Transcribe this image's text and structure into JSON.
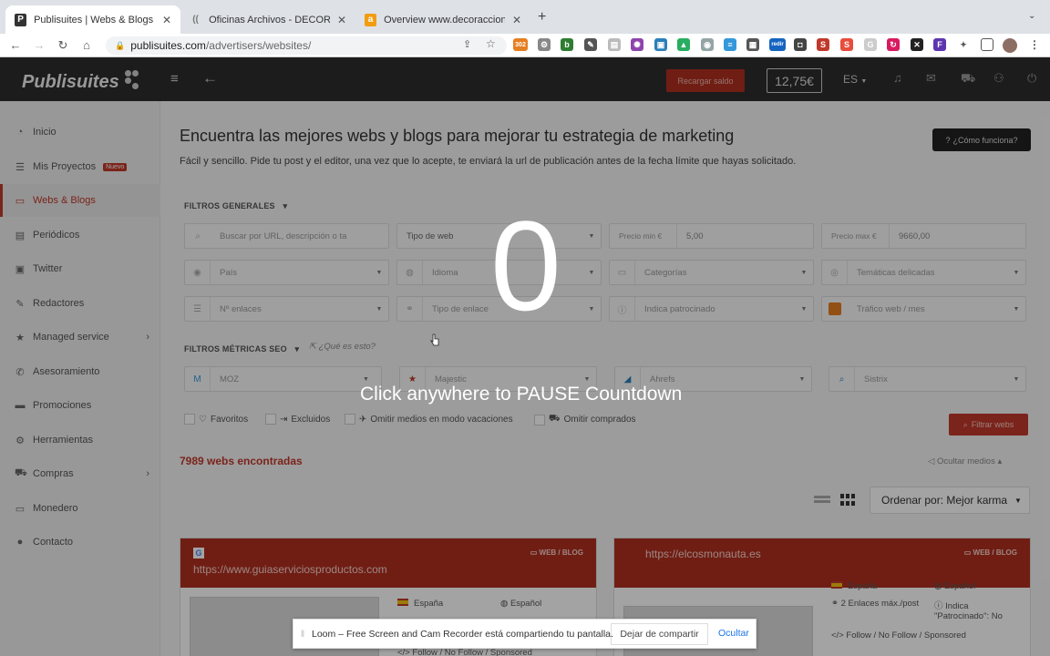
{
  "browser": {
    "tabs": [
      {
        "title": "Publisuites | Webs & Blogs",
        "favicon": "P"
      },
      {
        "title": "Oficinas Archivos - DECORACC",
        "favicon": "(("
      },
      {
        "title": "Overview www.decoraccion.es",
        "favicon": "a"
      }
    ],
    "new_tab": "+",
    "url_host": "publisuites.com",
    "url_path": "/advertisers/websites/",
    "ext_badge_302": "302",
    "ext_badge_redir": "redir"
  },
  "header": {
    "logo": "Publisuites",
    "recharge_label": "Recargar saldo",
    "balance": "12,75€",
    "lang": "ES"
  },
  "sidebar": {
    "items": [
      {
        "label": "Inicio",
        "icon": "dashboard-icon"
      },
      {
        "label": "Mis Proyectos",
        "icon": "list-icon",
        "badge": "Nuevo"
      },
      {
        "label": "Webs & Blogs",
        "icon": "webs-icon"
      },
      {
        "label": "Periódicos",
        "icon": "newspaper-icon"
      },
      {
        "label": "Twitter",
        "icon": "twitter-icon"
      },
      {
        "label": "Redactores",
        "icon": "pencil-icon"
      },
      {
        "label": "Managed service",
        "icon": "star-icon"
      },
      {
        "label": "Asesoramiento",
        "icon": "phone-icon"
      },
      {
        "label": "Promociones",
        "icon": "ticket-icon"
      },
      {
        "label": "Herramientas",
        "icon": "tools-icon"
      },
      {
        "label": "Compras",
        "icon": "cart-icon"
      },
      {
        "label": "Monedero",
        "icon": "wallet-icon"
      },
      {
        "label": "Contacto",
        "icon": "info-icon"
      }
    ]
  },
  "main": {
    "title": "Encuentra las mejores webs y blogs para mejorar tu estrategia de marketing",
    "subtitle": "Fácil y sencillo. Pide tu post y el editor, una vez que lo acepte, te enviará la url de publicación antes de la fecha límite que hayas solicitado.",
    "how_button": "¿Cómo funciona?",
    "filters_general": "FILTROS GENERALES",
    "search_placeholder": "Buscar por URL, descripción o ta",
    "web_type": "Tipo de web",
    "price_min_label": "Precio min €",
    "price_min_value": "5,00",
    "price_max_label": "Precio max €",
    "price_max_value": "9660,00",
    "country": "País",
    "language": "Idioma",
    "categories": "Categorías",
    "sensitive": "Temáticas delicadas",
    "links": "Nº enlaces",
    "link_type": "Tipo de enlace",
    "sponsored": "Indica patrocinado",
    "traffic": "Tráfico web / mes",
    "filters_seo": "FILTROS MÉTRICAS SEO",
    "what_is": "¿Qué es esto?",
    "moz": "MOZ",
    "majestic": "Majestic",
    "ahrefs": "Ahrefs",
    "sistrix": "Sistrix",
    "favorites": "Favoritos",
    "excluded": "Excluidos",
    "vacation": "Omitir medios en modo vacaciones",
    "purchased": "Omitir comprados",
    "filter_button": "Filtrar webs",
    "count": "7989 webs encontradas",
    "hide_media": "Ocultar medios",
    "sort": "Ordenar por: Mejor karma"
  },
  "cards": [
    {
      "url": "https://www.guiaserviciosproductos.com",
      "tag": "WEB / BLOG",
      "country": "España",
      "language": "Español",
      "follow": "Follow / No Follow / Sponsored"
    },
    {
      "url": "https://elcosmonauta.es",
      "tag": "WEB / BLOG",
      "country": "España",
      "language": "Español",
      "links": "2 Enlaces máx./post",
      "sponsored": "Indica \"Patrocinado\": No",
      "follow": "Follow / No Follow / Sponsored"
    }
  ],
  "overlay": {
    "countdown": "0",
    "pause_text": "Click anywhere to PAUSE Countdown"
  },
  "share_bar": {
    "message": "Loom – Free Screen and Cam Recorder está compartiendo tu pantalla.",
    "stop": "Dejar de compartir",
    "hide": "Ocultar"
  }
}
